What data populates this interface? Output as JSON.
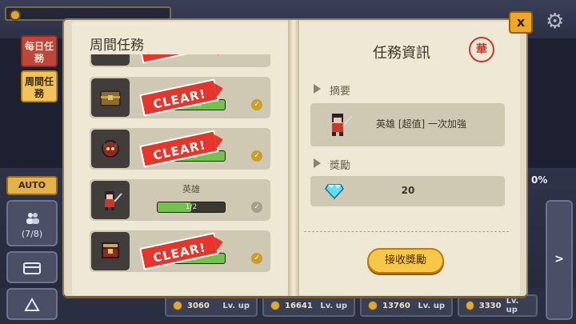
{
  "hud": {
    "tabs": {
      "daily": "每日任務",
      "weekly": "周間任務"
    },
    "auto_label": "AUTO",
    "party_count": "(7/8)",
    "percent": "0%",
    "right_arrow": ">",
    "stats": [
      {
        "value": "3060",
        "level": "Lv. up"
      },
      {
        "value": "16641",
        "level": "Lv. up"
      },
      {
        "value": "13760",
        "level": "Lv. up"
      },
      {
        "value": "3330",
        "level": "Lv. up"
      }
    ],
    "close_label": "x"
  },
  "left_page": {
    "title": "周間任務",
    "quests": [
      {
        "name": "",
        "progress": "20/20",
        "cleared": true,
        "icon": "chest-icon"
      },
      {
        "name": "",
        "progress": "3/3",
        "cleared": true,
        "icon": "demon-boss-icon"
      },
      {
        "name": "英雄",
        "progress": "1/2",
        "progress_fraction": 0.5,
        "cleared": false,
        "icon": "hero-icon"
      },
      {
        "name": "",
        "progress": "3/3",
        "cleared": true,
        "icon": "treasure-box-icon"
      }
    ],
    "clear_label": "CLEAR!"
  },
  "right_page": {
    "title": "任務資訊",
    "seal_text": "華",
    "summary_heading": "摘要",
    "summary_text": "英雄 [超值] 一次加強",
    "reward_heading": "獎勵",
    "reward_value": "20",
    "reward_icon": "diamond-icon",
    "claim_button": "接收獎勵"
  }
}
